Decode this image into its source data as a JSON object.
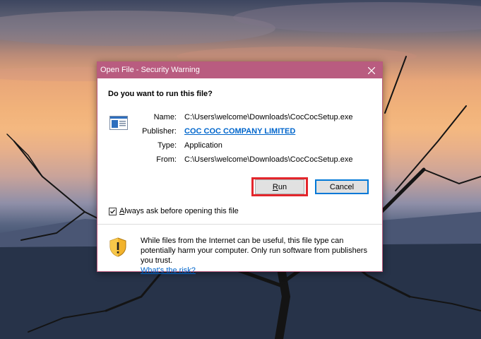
{
  "dialog": {
    "title": "Open File - Security Warning",
    "question": "Do you want to run this file?",
    "fields": {
      "name_label": "Name:",
      "name_value": "C:\\Users\\welcome\\Downloads\\CocCocSetup.exe",
      "publisher_label": "Publisher:",
      "publisher_value": "COC COC COMPANY LIMITED",
      "type_label": "Type:",
      "type_value": "Application",
      "from_label": "From:",
      "from_value": "C:\\Users\\welcome\\Downloads\\CocCocSetup.exe"
    },
    "run_accesskey": "R",
    "run_rest": "un",
    "cancel_label": "Cancel",
    "always_ask_accesskey": "A",
    "always_ask_rest": "lways ask before opening this file",
    "always_ask_checked": true,
    "warning_text": "While files from the Internet can be useful, this file type can potentially harm your computer. Only run software from publishers you trust.",
    "risk_link": "What's the risk?",
    "colors": {
      "titlebar": "#b95c80",
      "highlight": "#e3262c",
      "link": "#0066cc"
    },
    "icons": [
      "close-icon",
      "application-icon",
      "shield-warning-icon"
    ]
  }
}
